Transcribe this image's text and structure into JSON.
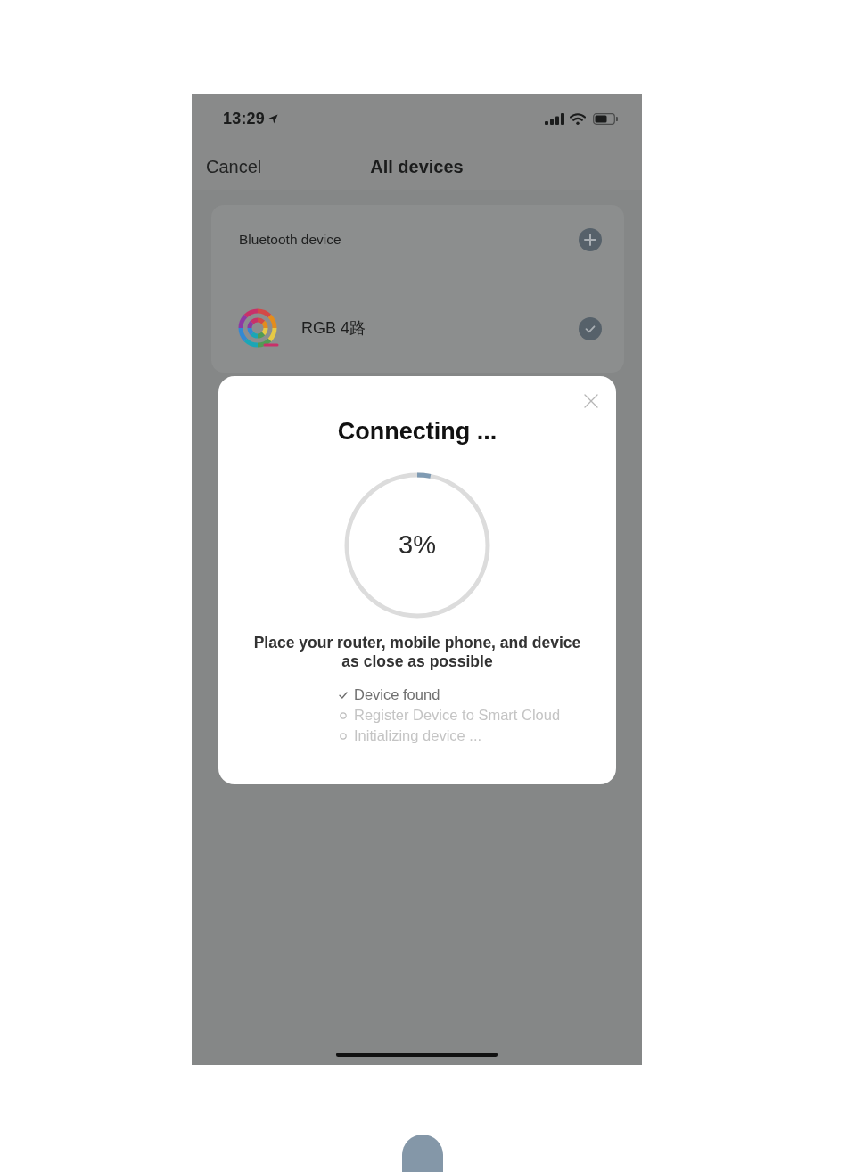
{
  "status_bar": {
    "time": "13:29"
  },
  "nav_bar": {
    "cancel": "Cancel",
    "title": "All devices"
  },
  "device_card": {
    "section_title": "Bluetooth device",
    "devices": [
      {
        "name": "RGB 4路",
        "selected": true
      }
    ]
  },
  "dialog": {
    "title": "Connecting ...",
    "progress": {
      "level": 0.03,
      "reading": "3%"
    },
    "message": "Place your router, mobile phone, and device as close as possible",
    "steps": [
      {
        "label": "Device found",
        "done": true
      },
      {
        "label": "Register Device to Smart Cloud",
        "done": false
      },
      {
        "label": "Initializing device ...",
        "done": false
      }
    ]
  }
}
